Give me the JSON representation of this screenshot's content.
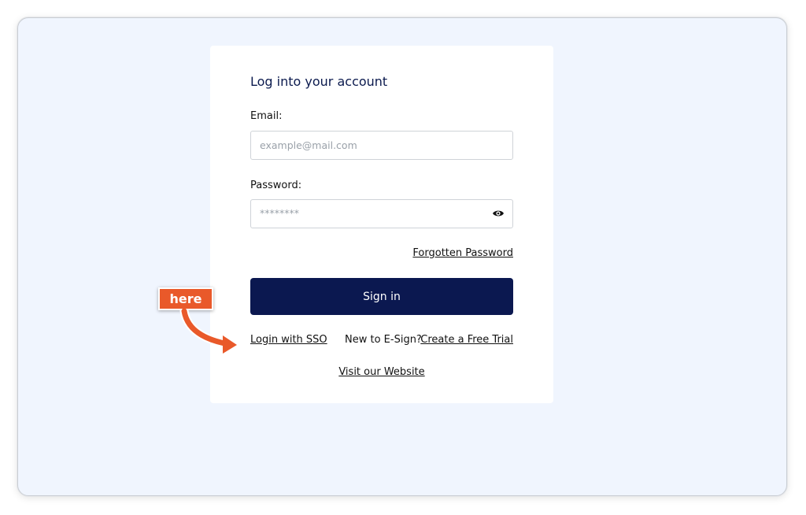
{
  "login": {
    "title": "Log into your account",
    "email_label": "Email:",
    "email_placeholder": "example@mail.com",
    "password_label": "Password:",
    "password_placeholder": "********",
    "forgot_label": "Forgotten Password",
    "signin_label": "Sign in",
    "sso_label": "Login with SSO",
    "new_text": "New to E-Sign?",
    "trial_label": "Create a Free Trial",
    "website_label": "Visit our Website"
  },
  "annotation": {
    "label": "here",
    "color": "#e9592a"
  },
  "colors": {
    "background": "#f0f5fe",
    "primary": "#0b1850"
  },
  "icons": {
    "password_toggle": "eye-icon"
  }
}
